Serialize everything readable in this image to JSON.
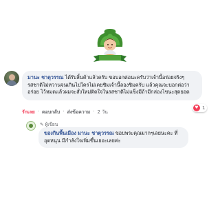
{
  "logo": {
    "icon": "community-logo-icon",
    "caption": "ชุมชนพอพึ่ง"
  },
  "comment": {
    "author": "มานะ ชาตุวรรณ",
    "text": " ได้รับสิ้นค้าแล้วครับ ขอบอกต่อนะครับว่าเจ้านี้อร่อยจริงๆรสชาติไม่หวานจนเกินไปใครไม่เคยชิมเจ้านี้ลองชิมครับ แล้วคุณจะบอกต่อว่าอร่อย ไว้หมดแล้วผมจะสั่งใหม่ติดใจในรสชาติไม่แข็งมีถ้ามีกล่องไขนะสุดยอด",
    "reaction_count": "1",
    "actions": {
      "love": "รักเลย",
      "reply": "ตอบกลับ",
      "send": "ส่งข้อความ",
      "time": "2 วัน"
    }
  },
  "reply": {
    "badge": "ผู้เขียน",
    "author": "ของกินพื้นเมือง",
    "mention": "มานะ ชาตุวรรณ",
    "text": " ขอบพระคุณมากๆเลยนะคะ ที่อุดหนุน มีกำลังใจเพิ่มขึ้นเยอะเลยค่ะ"
  },
  "colors": {
    "author_link": "#385898",
    "bubble_bg": "#f0f2f5",
    "love": "#f33e58",
    "muted": "#65676b"
  }
}
